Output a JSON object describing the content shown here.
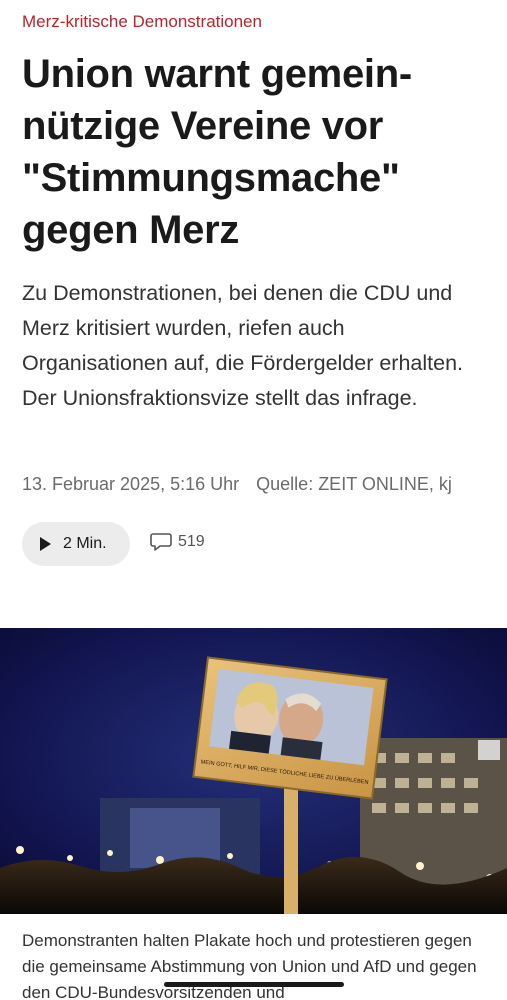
{
  "article": {
    "kicker": "Merz-kritische Demonstrationen",
    "headline": "Union warnt gemein­nützige Vereine vor \"Stimmungsmache\" gegen Merz",
    "teaser": "Zu Demonstrationen, bei denen die CDU und Merz kritisiert wurden, riefen auch Organisationen auf, die Fördergelder erhalten. Der Unionsfraktionsvize stellt das infrage.",
    "date": "13. Februar 2025, 5:16 Uhr",
    "source": "Quelle: ZEIT ONLINE, kj",
    "audio_label": "2 Min.",
    "comment_count": "519"
  },
  "image": {
    "sign_text": "MEIN GOTT, HILF MIR, DIESE TÖDLICHE LIEBE ZU ÜBERLEBEN",
    "caption": "Demonstranten halten Plakate hoch und protestieren gegen die gemeinsame Abstimmung von Union und AfD und gegen den CDU-Bundesvorsitzenden und"
  },
  "colors": {
    "kicker": "#b8242a",
    "night_sky": "#0d0f3a"
  }
}
